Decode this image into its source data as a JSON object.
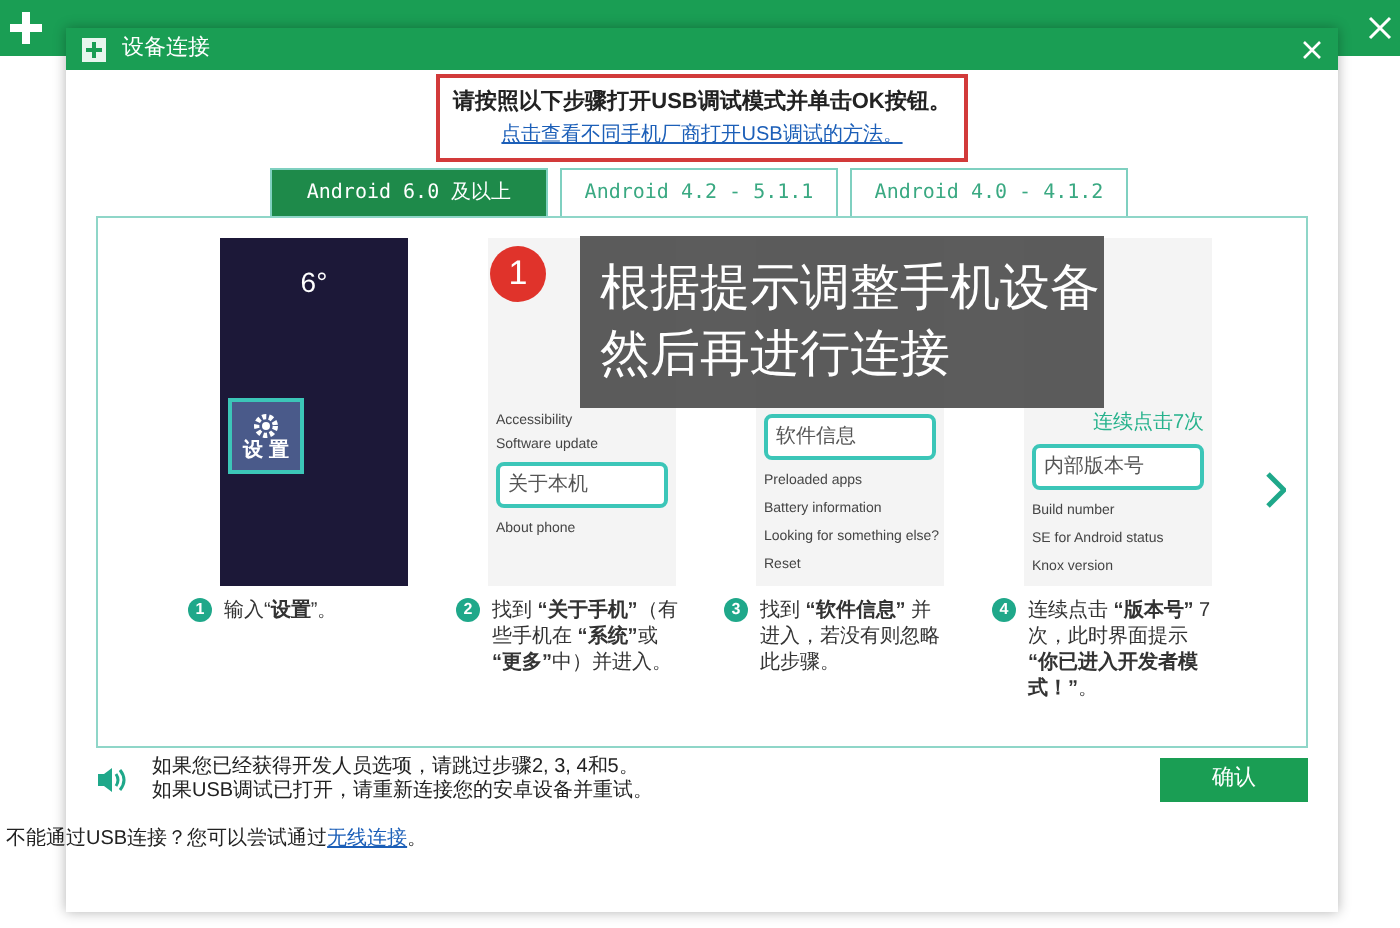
{
  "dialog": {
    "title": "设备连接"
  },
  "header": {
    "instruction": "请按照以下步骤打开USB调试模式并单击OK按钮。",
    "link": "点击查看不同手机厂商打开USB调试的方法。"
  },
  "tabs": [
    {
      "label": "Android 6.0 及以上",
      "selected": true
    },
    {
      "label": "Android 4.2 - 5.1.1",
      "selected": false
    },
    {
      "label": "Android 4.0 - 4.1.2",
      "selected": false
    }
  ],
  "steps": [
    {
      "number": "1",
      "text": "输入“**设置**”。",
      "screen": {
        "kind": "home",
        "lines": [
          "6°"
        ],
        "highlight": "设 置"
      }
    },
    {
      "number": "2",
      "text": "找到 **“关于手机”**（有些手机在 **“系统”**或 **“更多”**中）并进入。",
      "screen": {
        "kind": "list",
        "lines": [
          "Accessibility",
          "Software update"
        ],
        "highlight": "关于本机",
        "after": [
          "About phone"
        ]
      }
    },
    {
      "number": "3",
      "text": "找到 **“软件信息”** 并进入，若没有则忽略此步骤。",
      "screen": {
        "kind": "list",
        "highlight": "软件信息",
        "after": [
          "Preloaded apps",
          "Battery information",
          "Looking for something else?",
          "Reset"
        ]
      }
    },
    {
      "number": "4",
      "text": "连续点击 **“版本号”** 7次，此时界面提示 **“你已进入开发者模式！”**。",
      "screen": {
        "kind": "list",
        "badge": "连续点击7次",
        "highlight": "内部版本号",
        "after": [
          "Build number",
          "SE for Android status",
          "Knox version"
        ]
      }
    }
  ],
  "callout": {
    "number": "1",
    "lines": [
      "根据提示调整手机设备",
      "然后再进行连接"
    ]
  },
  "notes": [
    "如果您已经获得开发人员选项，请跳过步骤2, 3, 4和5。",
    "如果USB调试已打开，请重新连接您的安卓设备并重试。"
  ],
  "confirm_button": "确认",
  "footer": {
    "text": "不能通过USB连接？您可以尝试通过",
    "link": "无线连接",
    "end": "。"
  }
}
